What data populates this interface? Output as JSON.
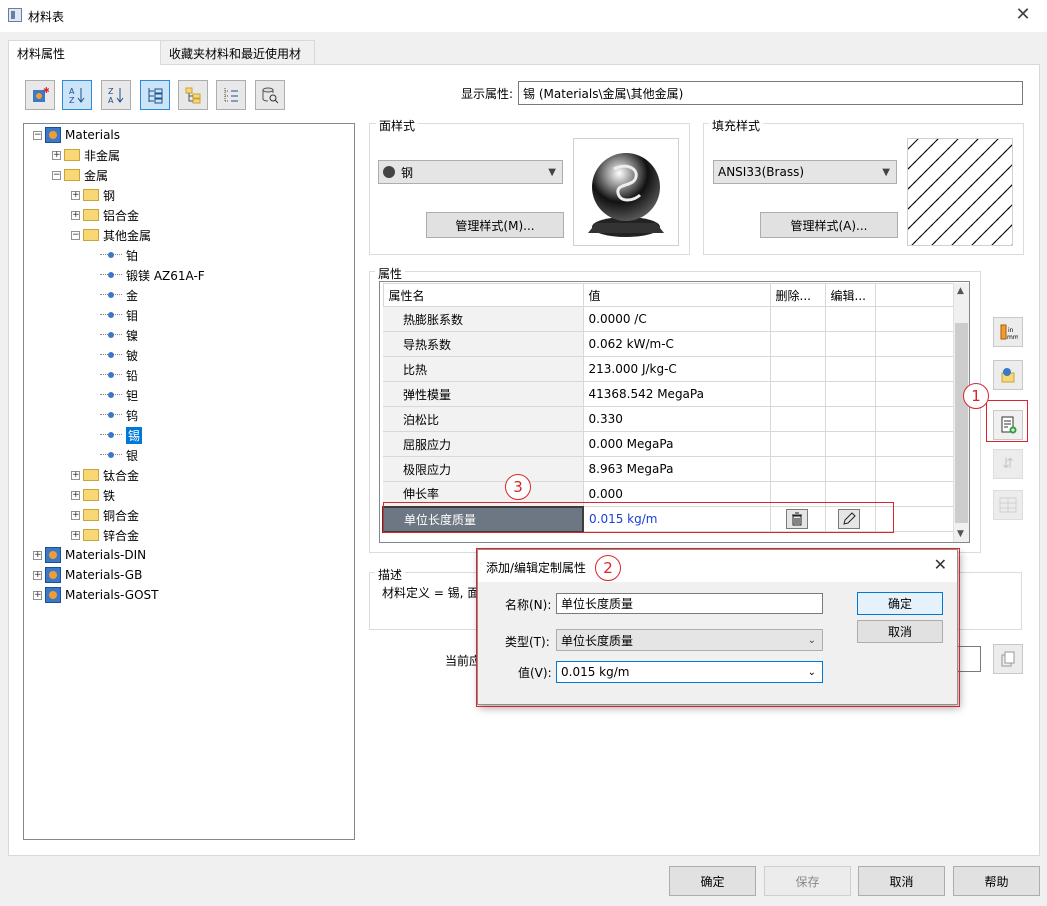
{
  "window": {
    "title": "材料表"
  },
  "tabs": [
    {
      "label": "材料属性"
    },
    {
      "label": "收藏夹材料和最近使用材料"
    }
  ],
  "toolbar_icons": [
    "new-material-icon",
    "sort-az-icon",
    "sort-za-icon",
    "tree-view-icon",
    "expand-tree-icon",
    "collapse-tree-icon",
    "search-database-icon"
  ],
  "tree": {
    "root": "Materials",
    "nonmetal": "非金属",
    "metal": "金属",
    "steel": "钢",
    "al": "铝合金",
    "othermetal": "其他金属",
    "leaves": [
      "铂",
      "锻镁 AZ61A-F",
      "金",
      "钼",
      "镍",
      "铍",
      "铅",
      "钽",
      "钨",
      "锡",
      "银"
    ],
    "ti": "钛合金",
    "iron": "铁",
    "cu": "铜合金",
    "zn": "锌合金",
    "din": "Materials-DIN",
    "gb": "Materials-GB",
    "gost": "Materials-GOST"
  },
  "display": {
    "label": "显示属性:",
    "value": "锡 (Materials\\金属\\其他金属)"
  },
  "face": {
    "label": "面样式",
    "combo": "钢",
    "button": "管理样式(M)..."
  },
  "fill": {
    "label": "填充样式",
    "combo": "ANSI33(Brass)",
    "button": "管理样式(A)..."
  },
  "props": {
    "label": "属性",
    "headers": [
      "属性名",
      "值",
      "删除...",
      "编辑..."
    ],
    "rows": [
      {
        "name": "热膨胀系数",
        "value": "0.0000 /C"
      },
      {
        "name": "导热系数",
        "value": "0.062 kW/m-C"
      },
      {
        "name": "比热",
        "value": "213.000 J/kg-C"
      },
      {
        "name": "弹性模量",
        "value": "41368.542 MegaPa"
      },
      {
        "name": "泊松比",
        "value": "0.330"
      },
      {
        "name": "屈服应力",
        "value": "0.000 MegaPa"
      },
      {
        "name": "极限应力",
        "value": "8.963 MegaPa"
      },
      {
        "name": "伸长率",
        "value": "0.000"
      },
      {
        "name": "单位长度质量",
        "value": "0.015 kg/m"
      }
    ]
  },
  "desc": {
    "label": "描述",
    "text": "材料定义 = 锡, 面"
  },
  "current": {
    "label": "当前应"
  },
  "callouts": [
    "1",
    "2",
    "3"
  ],
  "dialog": {
    "title": "添加/编辑定制属性",
    "name_label": "名称(N):",
    "name_value": "单位长度质量",
    "type_label": "类型(T):",
    "type_value": "单位长度质量",
    "value_label": "值(V):",
    "value_value": "0.015 kg/m",
    "ok": "确定",
    "cancel": "取消"
  },
  "footer": {
    "ok": "确定",
    "save": "保存",
    "cancel": "取消",
    "help": "帮助"
  },
  "colors": {
    "accent": "#0078d7",
    "callout": "#d9262c",
    "selected_row": "#6d7683"
  }
}
